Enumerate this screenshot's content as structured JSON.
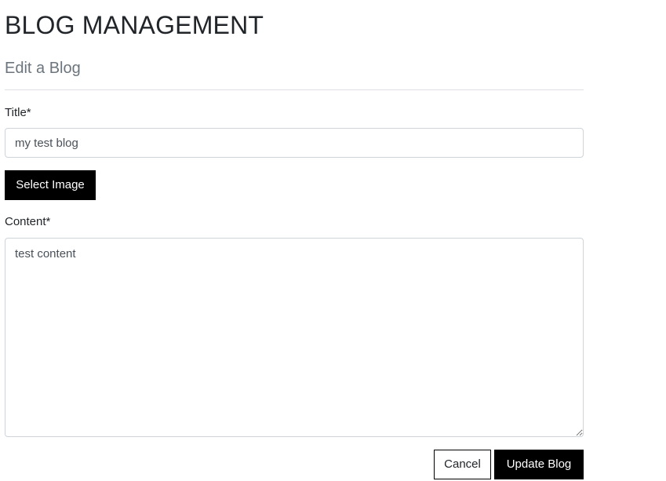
{
  "header": {
    "title": "BLOG MANAGEMENT"
  },
  "form": {
    "subtitle": "Edit a Blog",
    "title_field": {
      "label": "Title*",
      "value": "my test blog"
    },
    "select_image_label": "Select Image",
    "content_field": {
      "label": "Content*",
      "value": "test content"
    },
    "cancel_label": "Cancel",
    "submit_label": "Update Blog"
  },
  "colors": {
    "primary_button": "#000000",
    "subtitle": "#6c757d",
    "input_border": "#ced4da",
    "divider": "#dee2e6"
  }
}
